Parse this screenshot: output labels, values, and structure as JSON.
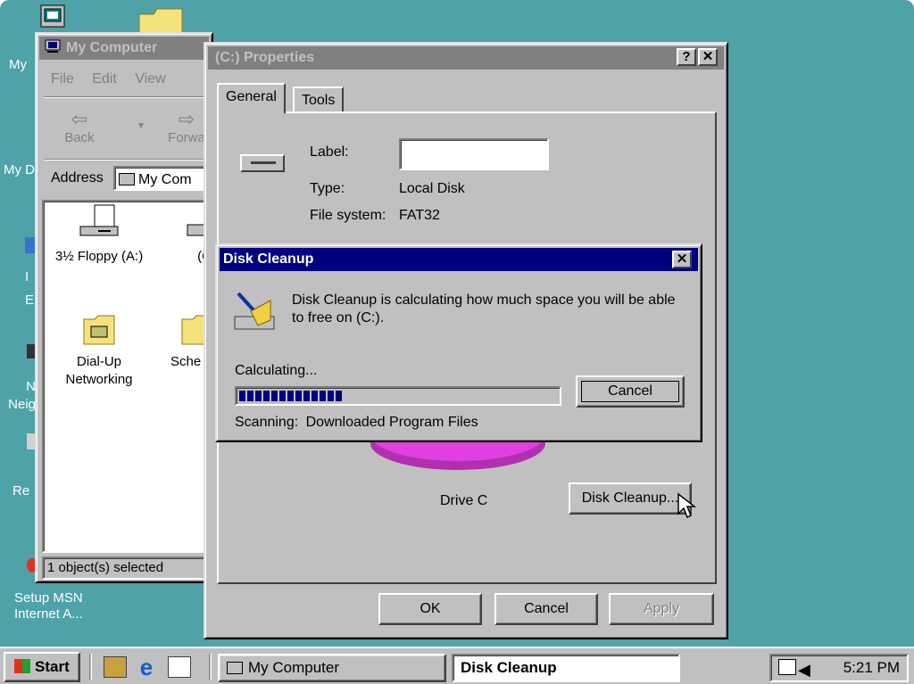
{
  "desktop": {
    "icons": [
      {
        "label": "My"
      },
      {
        "label": "My D"
      },
      {
        "label": "I E"
      },
      {
        "label": "N Neig"
      },
      {
        "label": "Re"
      },
      {
        "label": "Setup MSN Internet A..."
      }
    ]
  },
  "my_computer": {
    "title": "My Computer",
    "menu": [
      "File",
      "Edit",
      "View"
    ],
    "toolbar": {
      "back": "Back",
      "forward": "Forwa"
    },
    "address_label": "Address",
    "address_value": "My Com",
    "items": [
      {
        "label": "3½ Floppy (A:)"
      },
      {
        "label": "(C"
      },
      {
        "label": "Dial-Up Networking"
      },
      {
        "label": "Sche Ta"
      }
    ],
    "status": "1 object(s) selected"
  },
  "properties": {
    "title": "(C:) Properties",
    "title_buttons": {
      "help": "?",
      "close": "✕"
    },
    "tabs": [
      "General",
      "Tools"
    ],
    "label_caption": "Label:",
    "label_value": "",
    "type_caption": "Type:",
    "type_value": "Local Disk",
    "fs_caption": "File system:",
    "fs_value": "FAT32",
    "drive_caption": "Drive C",
    "disk_cleanup_button": "Disk Cleanup...",
    "buttons": {
      "ok": "OK",
      "cancel": "Cancel",
      "apply": "Apply"
    }
  },
  "disk_cleanup": {
    "title": "Disk Cleanup",
    "message": "Disk Cleanup is calculating how much space you will be able to free on  (C:).",
    "calculating": "Calculating...",
    "progress_blocks": 13,
    "progress_total_blocks": 40,
    "cancel": "Cancel",
    "scanning_label": "Scanning:",
    "scanning_item": "Downloaded Program Files"
  },
  "taskbar": {
    "start": "Start",
    "tasks": [
      {
        "label": "My Computer"
      },
      {
        "label": "Disk Cleanup"
      }
    ],
    "clock": "5:21 PM"
  },
  "colors": {
    "desktop": "#4ea2a8",
    "titlebar_active": "#000080",
    "titlebar_inactive": "#808080",
    "face": "#c0c0c0",
    "pie": "#e040e0"
  }
}
